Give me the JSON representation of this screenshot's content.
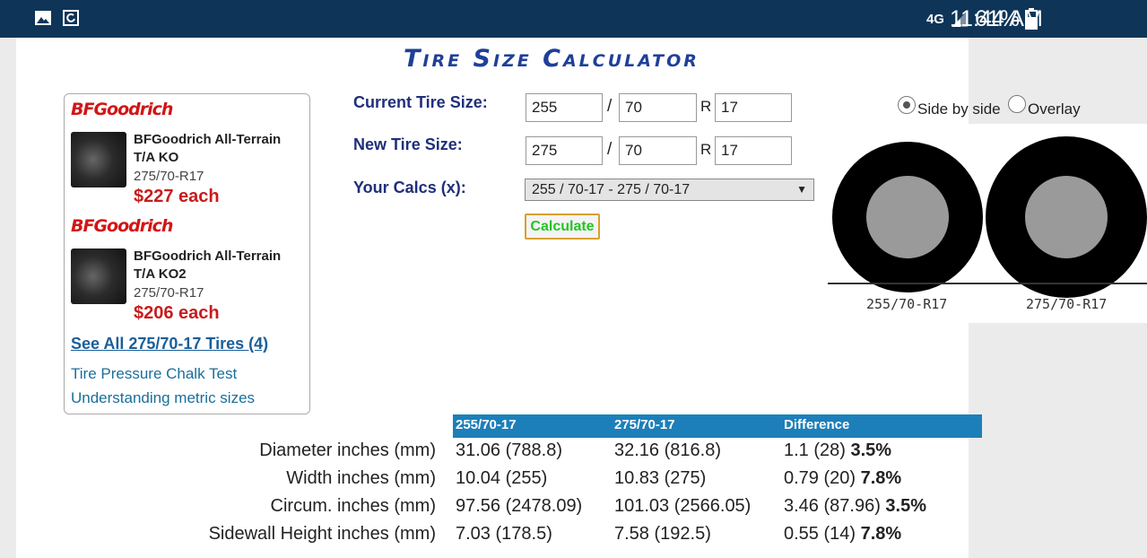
{
  "status_bar": {
    "network": "4G",
    "battery": "61%",
    "time": "11:44 AM",
    "icons": [
      "image-icon",
      "sync-icon",
      "signal-icon",
      "battery-icon"
    ]
  },
  "page_title": "Tire Size Calculator",
  "ad": {
    "products": [
      {
        "brand": "BFGoodrich",
        "name": "BFGoodrich All-Terrain T/A KO",
        "size": "275/70-R17",
        "price": "$227 each"
      },
      {
        "brand": "BFGoodrich",
        "name": "BFGoodrich All-Terrain T/A KO2",
        "size": "275/70-R17",
        "price": "$206 each"
      }
    ],
    "see_all": "See All 275/70-17 Tires (4)",
    "links": [
      "Tire Pressure Chalk Test",
      "Understanding metric sizes"
    ]
  },
  "form": {
    "current_label": "Current Tire Size:",
    "new_label": "New Tire Size:",
    "calcs_label": "Your Calcs (x):",
    "current": {
      "width": "255",
      "ratio": "70",
      "rim": "17"
    },
    "new": {
      "width": "275",
      "ratio": "70",
      "rim": "17"
    },
    "separator": "/",
    "rim_prefix": "R",
    "calcs_selected": "255 / 70-17 - 275 / 70-17",
    "calculate_label": "Calculate"
  },
  "view": {
    "side_by_side": "Side by side",
    "overlay": "Overlay",
    "selected": "side_by_side",
    "left_label": "255/70-R17",
    "right_label": "275/70-R17"
  },
  "table": {
    "headers": [
      "255/70-17",
      "275/70-17",
      "Difference"
    ],
    "rows": [
      {
        "label": "Diameter inches (mm)",
        "a": "31.06 (788.8)",
        "b": "32.16 (816.8)",
        "diff": "1.1 (28)",
        "pct": "3.5%"
      },
      {
        "label": "Width inches (mm)",
        "a": "10.04 (255)",
        "b": "10.83 (275)",
        "diff": "0.79 (20)",
        "pct": "7.8%"
      },
      {
        "label": "Circum. inches (mm)",
        "a": "97.56 (2478.09)",
        "b": "101.03 (2566.05)",
        "diff": "3.46 (87.96)",
        "pct": "3.5%"
      },
      {
        "label": "Sidewall Height inches (mm)",
        "a": "7.03 (178.5)",
        "b": "7.58 (192.5)",
        "diff": "0.55 (14)",
        "pct": "7.8%"
      }
    ]
  }
}
